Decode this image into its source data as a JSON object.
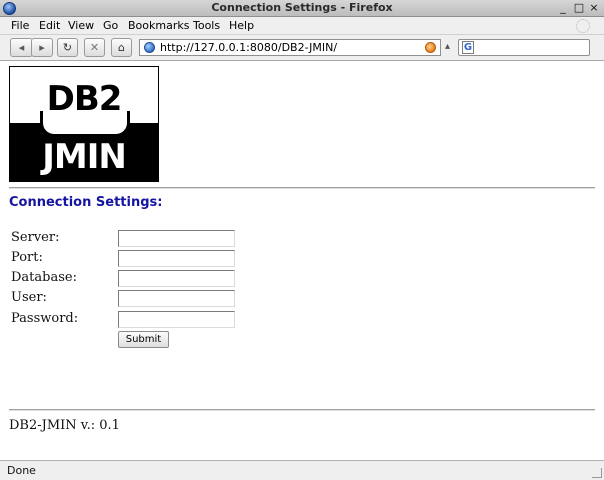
{
  "window": {
    "title": "Connection Settings - Firefox",
    "controls": {
      "minimize": "_",
      "maximize": "□",
      "close": "×"
    }
  },
  "menubar": {
    "items": [
      "File",
      "Edit",
      "View",
      "Go",
      "Bookmarks",
      "Tools",
      "Help"
    ]
  },
  "navbar": {
    "back": "◂",
    "forward": "▸",
    "reload": "↻",
    "stop": "✕",
    "home": "⌂",
    "url": "http://127.0.0.1:8080/DB2-JMIN/",
    "search_sep": "▴",
    "search_engine_letter": "G"
  },
  "logo": {
    "top_text": "DB2",
    "bottom_text": "JMIN"
  },
  "page": {
    "heading": "Connection Settings:",
    "fields": [
      {
        "label": "Server:",
        "value": ""
      },
      {
        "label": "Port:",
        "value": ""
      },
      {
        "label": "Database:",
        "value": ""
      },
      {
        "label": "User:",
        "value": ""
      },
      {
        "label": "Password:",
        "value": ""
      }
    ],
    "submit_label": "Submit",
    "version": "DB2-JMIN v.: 0.1"
  },
  "status": {
    "text": "Done"
  }
}
